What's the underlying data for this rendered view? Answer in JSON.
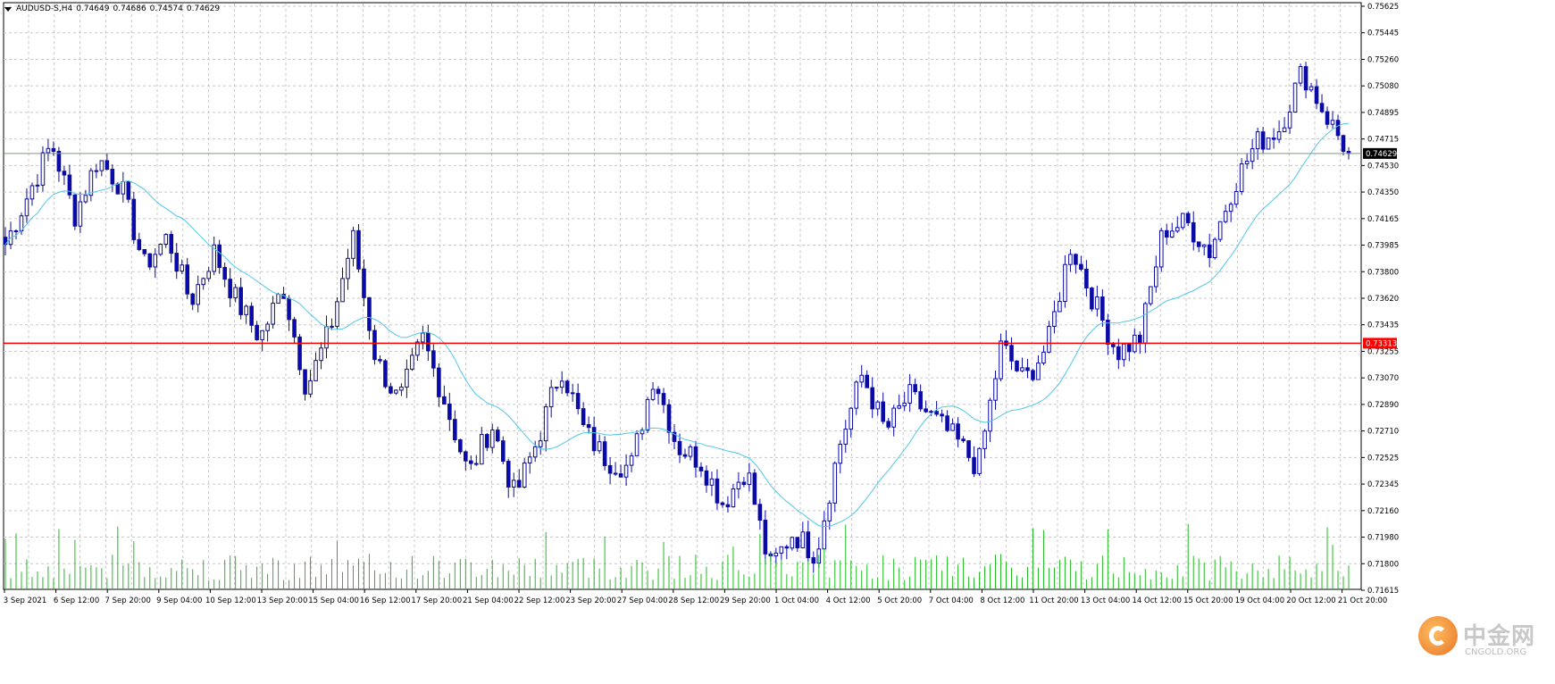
{
  "chart_data": {
    "type": "candlestick",
    "symbol": "AUDUSD-S,H4",
    "ohlc_header": [
      "0.74649",
      "0.74686",
      "0.74574",
      "0.74629"
    ],
    "price_axis_ticks": [
      "0.75625",
      "0.75445",
      "0.75260",
      "0.75080",
      "0.74895",
      "0.74715",
      "0.74530",
      "0.74350",
      "0.74165",
      "0.73985",
      "0.73800",
      "0.73620",
      "0.73435",
      "0.73255",
      "0.73070",
      "0.72890",
      "0.72710",
      "0.72525",
      "0.72345",
      "0.72160",
      "0.71980",
      "0.71800",
      "0.71615"
    ],
    "time_axis_ticks": [
      "3 Sep 2021",
      "6 Sep 12:00",
      "7 Sep 20:00",
      "9 Sep 04:00",
      "10 Sep 12:00",
      "13 Sep 20:00",
      "15 Sep 04:00",
      "16 Sep 12:00",
      "17 Sep 20:00",
      "21 Sep 04:00",
      "22 Sep 12:00",
      "23 Sep 20:00",
      "27 Sep 04:00",
      "28 Sep 12:00",
      "29 Sep 20:00",
      "1 Oct 04:00",
      "4 Oct 12:00",
      "5 Oct 20:00",
      "7 Oct 04:00",
      "8 Oct 12:00",
      "11 Oct 20:00",
      "13 Oct 04:00",
      "14 Oct 12:00",
      "15 Oct 20:00",
      "19 Oct 04:00",
      "20 Oct 12:00",
      "21 Oct 20:00"
    ],
    "y_range": [
      0.716,
      0.7565
    ],
    "current_price_label": "0.74629",
    "horizontal_line_label": "0.73313",
    "horizontal_line_price": 0.73313,
    "current_price": 0.74629,
    "anchor_closes": [
      0.74,
      0.7435,
      0.747,
      0.742,
      0.746,
      0.744,
      0.7385,
      0.7405,
      0.736,
      0.7395,
      0.736,
      0.7335,
      0.737,
      0.73,
      0.734,
      0.7405,
      0.732,
      0.729,
      0.7335,
      0.729,
      0.724,
      0.7275,
      0.7225,
      0.7265,
      0.7315,
      0.727,
      0.725,
      0.7245,
      0.731,
      0.726,
      0.725,
      0.722,
      0.7245,
      0.7175,
      0.72,
      0.7185,
      0.726,
      0.731,
      0.727,
      0.7295,
      0.728,
      0.7265,
      0.7245,
      0.733,
      0.7305,
      0.733,
      0.74,
      0.736,
      0.7325,
      0.7335,
      0.741,
      0.7415,
      0.7395,
      0.744,
      0.747,
      0.748,
      0.752,
      0.749,
      0.7463
    ],
    "colors": {
      "candle": "#0a0aa6",
      "ma_line": "#4fc8e8",
      "horizontal_line": "#ff0000",
      "current_line": "#7d9a7d",
      "volume": "#22bb22",
      "grid": "#c8c8c8",
      "tag_red": "#ff0000",
      "tag_black": "#000000"
    }
  },
  "watermark": {
    "title": "中金网",
    "subtitle": "CNGOLD.ORG"
  }
}
